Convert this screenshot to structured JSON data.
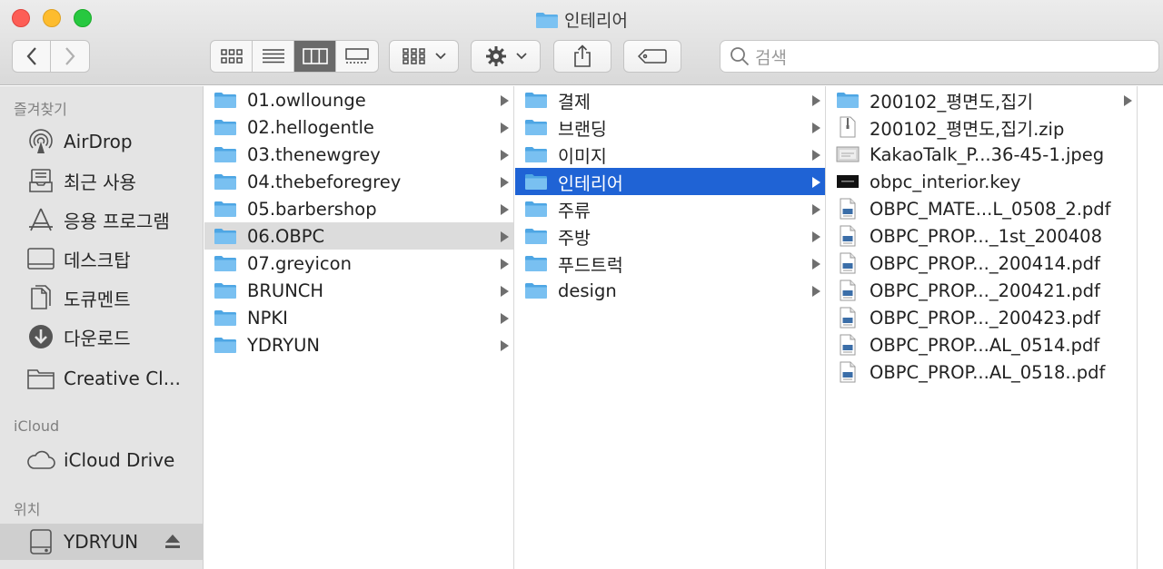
{
  "window": {
    "title": "인테리어"
  },
  "toolbar": {
    "search_placeholder": "검색"
  },
  "sidebar": {
    "favorites_header": "즐겨찾기",
    "favorites": [
      {
        "label": "AirDrop",
        "icon": "airdrop-icon"
      },
      {
        "label": "최근 사용",
        "icon": "recents-icon"
      },
      {
        "label": "응용 프로그램",
        "icon": "applications-icon"
      },
      {
        "label": "데스크탑",
        "icon": "desktop-icon"
      },
      {
        "label": "도큐멘트",
        "icon": "documents-icon"
      },
      {
        "label": "다운로드",
        "icon": "downloads-icon"
      },
      {
        "label": "Creative Cl...",
        "icon": "folder-icon"
      }
    ],
    "icloud_header": "iCloud",
    "icloud": [
      {
        "label": "iCloud Drive",
        "icon": "cloud-icon"
      }
    ],
    "locations_header": "위치",
    "locations": [
      {
        "label": "YDRYUN",
        "icon": "disk-icon"
      }
    ]
  },
  "columns": [
    {
      "items": [
        {
          "name": "01.owllounge",
          "type": "folder"
        },
        {
          "name": "02.hellogentle",
          "type": "folder"
        },
        {
          "name": "03.thenewgrey",
          "type": "folder"
        },
        {
          "name": "04.thebeforegrey",
          "type": "folder"
        },
        {
          "name": "05.barbershop",
          "type": "folder"
        },
        {
          "name": "06.OBPC",
          "type": "folder",
          "state": "path"
        },
        {
          "name": "07.greyicon",
          "type": "folder"
        },
        {
          "name": "BRUNCH",
          "type": "folder"
        },
        {
          "name": "NPKI",
          "type": "folder"
        },
        {
          "name": "YDRYUN",
          "type": "folder"
        }
      ]
    },
    {
      "items": [
        {
          "name": "결제",
          "type": "folder"
        },
        {
          "name": "브랜딩",
          "type": "folder"
        },
        {
          "name": "이미지",
          "type": "folder"
        },
        {
          "name": "인테리어",
          "type": "folder",
          "state": "selected"
        },
        {
          "name": "주류",
          "type": "folder"
        },
        {
          "name": "주방",
          "type": "folder"
        },
        {
          "name": "푸드트럭",
          "type": "folder"
        },
        {
          "name": "design",
          "type": "folder"
        }
      ]
    },
    {
      "items": [
        {
          "name": "200102_평면도,집기",
          "type": "folder"
        },
        {
          "name": "200102_평면도,집기.zip",
          "type": "zip"
        },
        {
          "name": "KakaoTalk_P...36-45-1.jpeg",
          "type": "jpeg"
        },
        {
          "name": "obpc_interior.key",
          "type": "keynote"
        },
        {
          "name": "OBPC_MATE...L_0508_2.pdf",
          "type": "pdf"
        },
        {
          "name": "OBPC_PROP..._1st_200408",
          "type": "pdf"
        },
        {
          "name": "OBPC_PROP..._200414.pdf",
          "type": "pdf"
        },
        {
          "name": "OBPC_PROP..._200421.pdf",
          "type": "pdf"
        },
        {
          "name": "OBPC_PROP..._200423.pdf",
          "type": "pdf"
        },
        {
          "name": "OBPC_PROP...AL_0514.pdf",
          "type": "pdf"
        },
        {
          "name": "OBPC_PROP...AL_0518..pdf",
          "type": "pdf"
        }
      ]
    }
  ],
  "colors": {
    "selection": "#1f63d5",
    "path_highlight": "#dcdcdc",
    "folder_blue": "#67b6ec",
    "sidebar_bg": "#e4e4e4"
  }
}
